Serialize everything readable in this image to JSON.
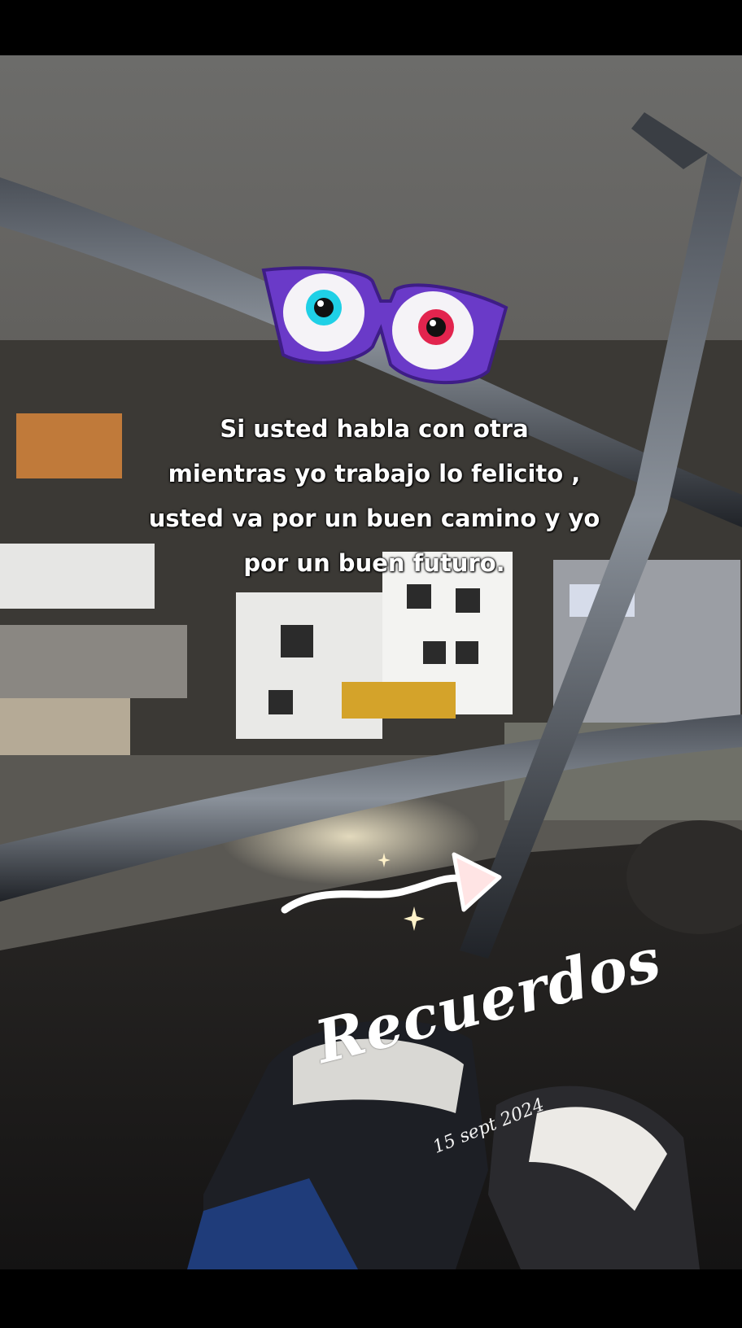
{
  "caption": {
    "line1": "Si usted habla con otra",
    "line2": "mientras yo trabajo lo felicito ,",
    "line3": "usted va por un buen camino y yo",
    "line4": "por un buen futuro."
  },
  "title": "Recuerdos",
  "date": "15 sept 2024",
  "icons": {
    "glasses": "googly-eyes-glasses-sticker",
    "arrow": "swoosh-arrow-sticker",
    "sparkle": "sparkle-icon"
  },
  "colors": {
    "glasses_frame": "#6a3ac8",
    "eye_left_iris": "#1fd0e6",
    "eye_right_iris": "#e2244e",
    "text": "#ffffff"
  }
}
